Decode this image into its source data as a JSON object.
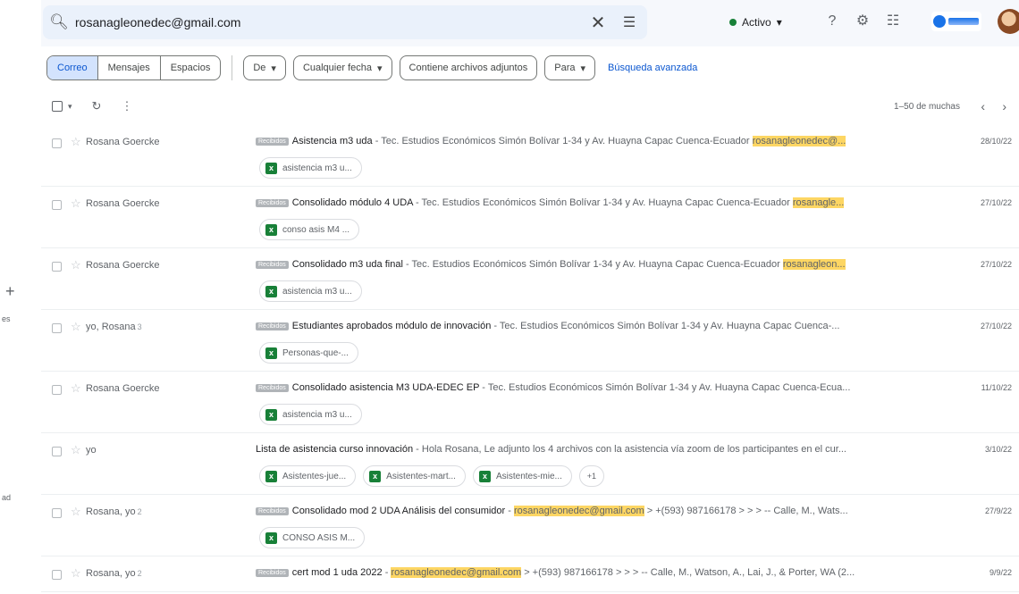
{
  "rail": {
    "plus": "+",
    "text1": "es",
    "text2": "ad"
  },
  "search": {
    "query": "rosanagleonedec@gmail.com",
    "icon": "search-icon",
    "clear_icon": "close-icon",
    "options_icon": "tune-icon"
  },
  "header": {
    "status_label": "Activo",
    "status_color": "#188038",
    "icons": [
      "help-icon",
      "gear-icon",
      "apps-icon"
    ]
  },
  "filters": {
    "segments": [
      "Correo",
      "Mensajes",
      "Espacios"
    ],
    "selected_segment": "Correo",
    "chips": [
      "De",
      "Cualquier fecha",
      "Contiene archivos adjuntos",
      "Para"
    ],
    "advanced": "Búsqueda avanzada"
  },
  "toolbar": {
    "paging": "1–50 de muchas"
  },
  "emails": [
    {
      "sender": "Rosana Goercke",
      "count": "",
      "badge": "Recibidos",
      "subject": "Asistencia m3 uda",
      "snippet": " - Tec. Estudios Económicos Simón Bolívar 1-34 y Av. Huayna Capac Cuenca-Ecuador ",
      "highlight": "rosanagleonedec@...",
      "tail": "",
      "date": "28/10/22",
      "attachments": [
        "asistencia m3 u..."
      ],
      "more": ""
    },
    {
      "sender": "Rosana Goercke",
      "count": "",
      "badge": "Recibidos",
      "subject": "Consolidado módulo 4 UDA",
      "snippet": " - Tec. Estudios Económicos Simón Bolívar 1-34 y Av. Huayna Capac Cuenca-Ecuador ",
      "highlight": "rosanagle...",
      "tail": "",
      "date": "27/10/22",
      "attachments": [
        "conso asis M4 ..."
      ],
      "more": ""
    },
    {
      "sender": "Rosana Goercke",
      "count": "",
      "badge": "Recibidos",
      "subject": "Consolidado m3 uda final",
      "snippet": " - Tec. Estudios Económicos Simón Bolívar 1-34 y Av. Huayna Capac Cuenca-Ecuador ",
      "highlight": "rosanagleon...",
      "tail": "",
      "date": "27/10/22",
      "attachments": [
        "asistencia m3 u..."
      ],
      "more": ""
    },
    {
      "sender": "yo, Rosana",
      "count": "3",
      "badge": "Recibidos",
      "subject": "Estudiantes aprobados módulo de innovación",
      "snippet": " - Tec. Estudios Económicos Simón Bolívar 1-34 y Av. Huayna Capac Cuenca-...",
      "highlight": "",
      "tail": "",
      "date": "27/10/22",
      "attachments": [
        "Personas-que-..."
      ],
      "more": ""
    },
    {
      "sender": "Rosana Goercke",
      "count": "",
      "badge": "Recibidos",
      "subject": "Consolidado asistencia M3 UDA-EDEC EP",
      "snippet": " - Tec. Estudios Económicos Simón Bolívar 1-34 y Av. Huayna Capac Cuenca-Ecua...",
      "highlight": "",
      "tail": "",
      "date": "11/10/22",
      "attachments": [
        "asistencia m3 u..."
      ],
      "more": ""
    },
    {
      "sender": "yo",
      "count": "",
      "badge": "",
      "subject": "Lista de asistencia curso innovación",
      "snippet": " - Hola Rosana, Le adjunto los 4 archivos con la asistencia vía zoom de los participantes en el cur...",
      "highlight": "",
      "tail": "",
      "date": "3/10/22",
      "attachments": [
        "Asistentes-jue...",
        "Asistentes-mart...",
        "Asistentes-mie..."
      ],
      "more": "+1"
    },
    {
      "sender": "Rosana, yo",
      "count": "2",
      "badge": "Recibidos",
      "subject": "Consolidado mod 2 UDA Análisis del consumidor",
      "snippet": " - ",
      "highlight": "rosanagleonedec@gmail.com",
      "tail": " > +(593) 987166178 > > > -- Calle, M., Wats...",
      "date": "27/9/22",
      "attachments": [
        "CONSO ASIS M..."
      ],
      "more": ""
    },
    {
      "sender": "Rosana, yo",
      "count": "2",
      "badge": "Recibidos",
      "subject": "cert mod 1 uda 2022",
      "snippet": " - ",
      "highlight": "rosanagleonedec@gmail.com",
      "tail": " > +(593) 987166178 > > > -- Calle, M., Watson, A., Lai, J., & Porter, WA (2...",
      "date": "9/9/22",
      "attachments": [],
      "more": ""
    }
  ]
}
